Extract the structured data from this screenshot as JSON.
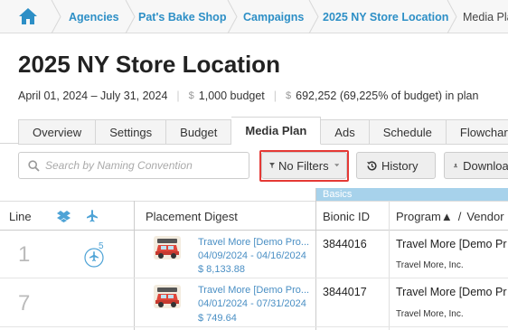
{
  "breadcrumb": {
    "items": [
      "Agencies",
      "Pat's Bake Shop",
      "Campaigns",
      "2025 NY Store Location"
    ],
    "current": "Media Pla"
  },
  "page": {
    "title": "2025 NY Store Location",
    "date_range": "April 01, 2024 – July 31, 2024",
    "budget_currency": "$",
    "budget": "1,000 budget",
    "planned_currency": "$",
    "planned": "692,252 (69,225% of budget) in plan"
  },
  "tabs": [
    "Overview",
    "Settings",
    "Budget",
    "Media Plan",
    "Ads",
    "Schedule",
    "Flowchart"
  ],
  "active_tab": "Media Plan",
  "toolbar": {
    "search_placeholder": "Search by Naming Convention",
    "filters_label": "No Filters",
    "history_label": "History",
    "download_label": "Download"
  },
  "table": {
    "group_band": "Basics",
    "headers": {
      "line": "Line",
      "placement": "Placement Digest",
      "bionic": "Bionic ID",
      "program": "Program▲",
      "slash": "/",
      "vendor": "Vendor"
    },
    "rows": [
      {
        "line": "1",
        "badge": "5",
        "name": "Travel More [Demo Pro...",
        "dates": "04/09/2024 - 04/16/2024",
        "amount": "$ 8,133.88",
        "bionic_id": "3844016",
        "program": "Travel More [Demo Pr",
        "vendor": "Travel More, Inc."
      },
      {
        "line": "7",
        "badge": "",
        "name": "Travel More [Demo Pro...",
        "dates": "04/01/2024 - 07/31/2024",
        "amount": "$ 749.64",
        "bionic_id": "3844017",
        "program": "Travel More [Demo Pr",
        "vendor": "Travel More, Inc."
      }
    ]
  },
  "colors": {
    "link": "#2d8fc6",
    "band": "#a7d2eb",
    "highlight": "#e53935"
  }
}
